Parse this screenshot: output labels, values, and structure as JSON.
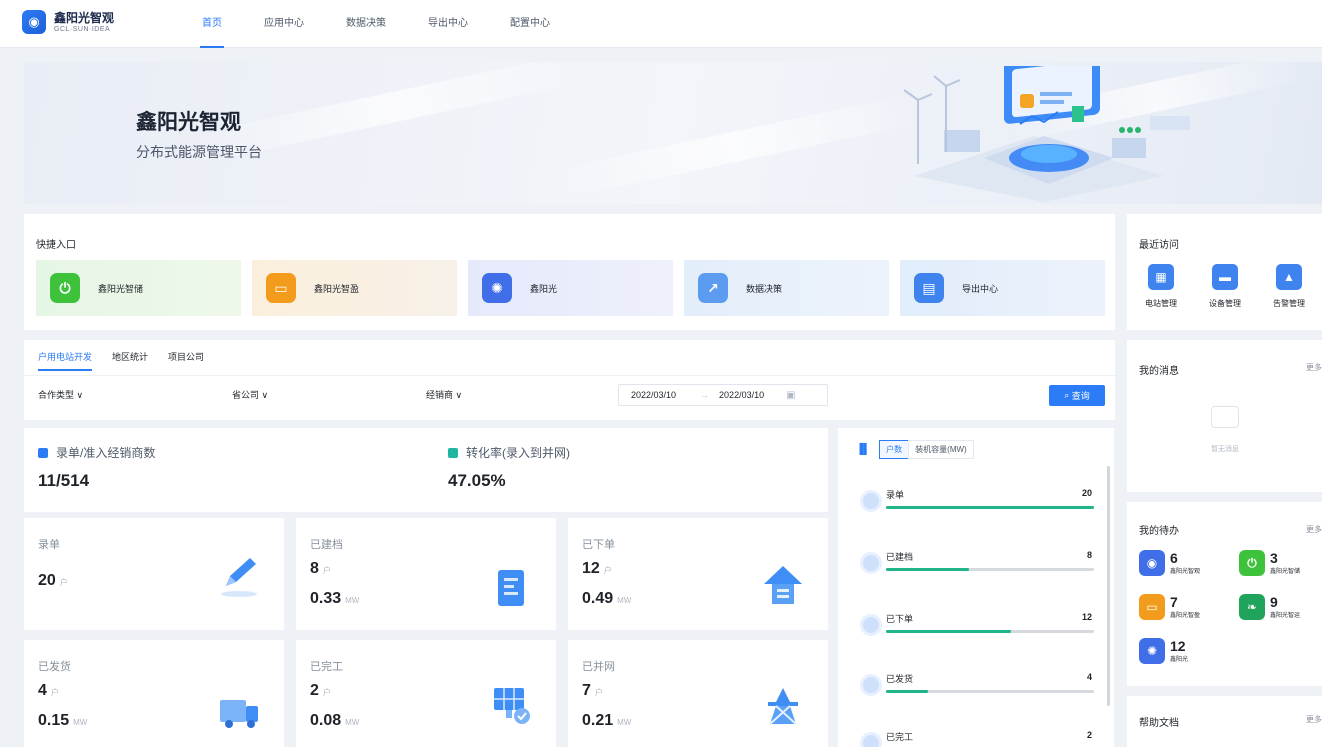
{
  "brand": {
    "name_cn": "鑫阳光智观",
    "name_en": "GCL·SUN·IDEA"
  },
  "nav": {
    "items": [
      {
        "label": "首页",
        "active": true
      },
      {
        "label": "应用中心",
        "active": false
      },
      {
        "label": "数据决策",
        "active": false
      },
      {
        "label": "导出中心",
        "active": false
      },
      {
        "label": "配置中心",
        "active": false
      }
    ]
  },
  "banner": {
    "title": "鑫阳光智观",
    "subtitle": "分布式能源管理平台"
  },
  "quick_access": {
    "title": "快捷入口",
    "items": [
      {
        "label": "鑫阳光智储",
        "icon": "power-icon",
        "color": "#3ec23c"
      },
      {
        "label": "鑫阳光智盈",
        "icon": "storage-icon",
        "color": "#f29b1c"
      },
      {
        "label": "鑫阳光",
        "icon": "sun-icon",
        "color": "#3f6ee8"
      },
      {
        "label": "数据决策",
        "icon": "chart-icon",
        "color": "#5b9cf0"
      },
      {
        "label": "导出中心",
        "icon": "folder-export-icon",
        "color": "#3e83ee"
      }
    ]
  },
  "recent": {
    "title": "最近访问",
    "items": [
      {
        "label": "电站管理",
        "icon": "station-icon"
      },
      {
        "label": "设备管理",
        "icon": "device-icon"
      },
      {
        "label": "告警管理",
        "icon": "alarm-icon"
      }
    ]
  },
  "filter": {
    "tabs": [
      {
        "label": "户用电站开发",
        "active": true
      },
      {
        "label": "地区统计",
        "active": false
      },
      {
        "label": "项目公司",
        "active": false
      }
    ],
    "dropdowns": [
      {
        "label": "合作类型"
      },
      {
        "label": "省公司"
      },
      {
        "label": "经销商"
      }
    ],
    "date_start": "2022/03/10",
    "date_sep": "→",
    "date_end": "2022/03/10",
    "query_label": "查询"
  },
  "summary": {
    "left": {
      "label": "录单/准入经销商数",
      "value": "11/514",
      "color": "#2b7cf6"
    },
    "right": {
      "label": "转化率(录入到并网)",
      "value": "47.05%",
      "color": "#1fb5a0"
    }
  },
  "stats": [
    {
      "label": "录单",
      "count": "20",
      "count_unit": "户",
      "capacity": "",
      "capacity_unit": "",
      "icon": "pen-icon"
    },
    {
      "label": "已建档",
      "count": "8",
      "count_unit": "户",
      "capacity": "0.33",
      "capacity_unit": "MW",
      "icon": "document-icon"
    },
    {
      "label": "已下单",
      "count": "12",
      "count_unit": "户",
      "capacity": "0.49",
      "capacity_unit": "MW",
      "icon": "order-icon"
    },
    {
      "label": "已发货",
      "count": "4",
      "count_unit": "户",
      "capacity": "0.15",
      "capacity_unit": "MW",
      "icon": "truck-icon"
    },
    {
      "label": "已完工",
      "count": "2",
      "count_unit": "户",
      "capacity": "0.08",
      "capacity_unit": "MW",
      "icon": "solar-panel-icon"
    },
    {
      "label": "已并网",
      "count": "7",
      "count_unit": "户",
      "capacity": "0.21",
      "capacity_unit": "MW",
      "icon": "grid-tower-icon"
    }
  ],
  "funnel": {
    "tabs": [
      {
        "label": "户数",
        "active": true
      },
      {
        "label": "装机容量(MW)",
        "active": false
      }
    ],
    "max": 20,
    "rows": [
      {
        "label": "录单",
        "value": 20
      },
      {
        "label": "已建档",
        "value": 8
      },
      {
        "label": "已下单",
        "value": 12
      },
      {
        "label": "已发货",
        "value": 4
      },
      {
        "label": "已完工",
        "value": 2
      }
    ]
  },
  "messages": {
    "title": "我的消息",
    "more": "更多",
    "empty": "暂无消息"
  },
  "todos": {
    "title": "我的待办",
    "more": "更多",
    "items": [
      {
        "count": "6",
        "label": "鑫阳光智观",
        "color": "#3f6ee8"
      },
      {
        "count": "3",
        "label": "鑫阳光智储",
        "color": "#3ec23c"
      },
      {
        "count": "7",
        "label": "鑫阳光智盈",
        "color": "#f29b1c"
      },
      {
        "count": "9",
        "label": "鑫阳光智运",
        "color": "#20a35a"
      },
      {
        "count": "12",
        "label": "鑫阳光",
        "color": "#3f6ee8"
      }
    ]
  },
  "help": {
    "title": "帮助文档",
    "more": "更多"
  }
}
